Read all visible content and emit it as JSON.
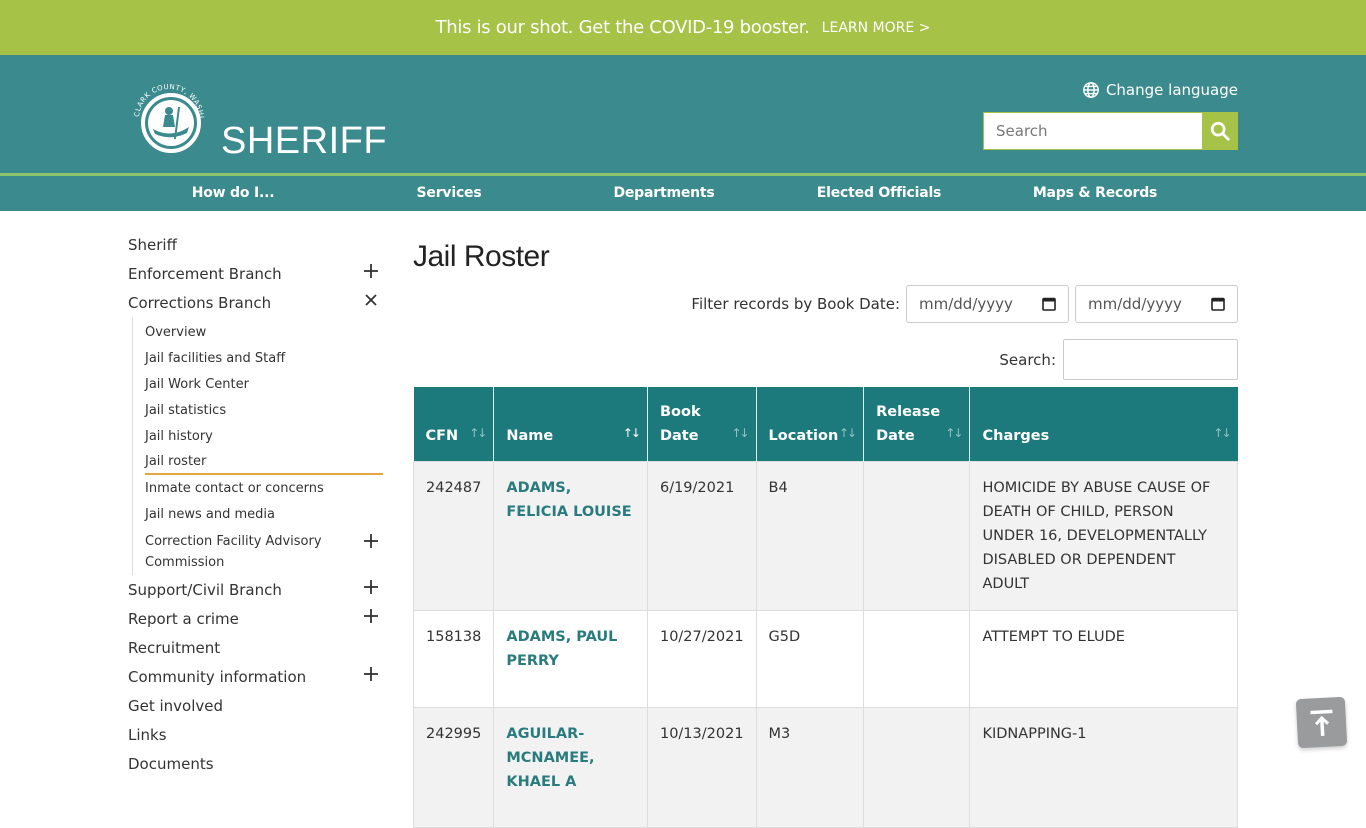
{
  "banner": {
    "message": "This is our shot. Get the COVID-19 booster.",
    "link": "LEARN MORE >"
  },
  "header": {
    "seal_text": "CLARK COUNTY, WASHINGTON",
    "brand": "SHERIFF",
    "change_language": "Change language",
    "search_placeholder": "Search"
  },
  "nav": {
    "items": [
      "How do I...",
      "Services",
      "Departments",
      "Elected Officials",
      "Maps & Records"
    ]
  },
  "sidebar": {
    "items": [
      {
        "label": "Sheriff",
        "toggle": null
      },
      {
        "label": "Enforcement Branch",
        "toggle": "plus"
      },
      {
        "label": "Corrections Branch",
        "toggle": "close"
      }
    ],
    "sub_items": [
      {
        "label": "Overview"
      },
      {
        "label": "Jail facilities and Staff"
      },
      {
        "label": "Jail Work Center"
      },
      {
        "label": "Jail statistics"
      },
      {
        "label": "Jail history"
      },
      {
        "label": "Jail roster",
        "active": true
      },
      {
        "label": "Inmate contact or concerns"
      },
      {
        "label": "Jail news and media"
      },
      {
        "label": "Correction Facility Advisory Commission",
        "toggle": "plus"
      }
    ],
    "items_after": [
      {
        "label": "Support/Civil Branch",
        "toggle": "plus"
      },
      {
        "label": "Report a crime",
        "toggle": "plus"
      },
      {
        "label": "Recruitment",
        "toggle": null
      },
      {
        "label": "Community information",
        "toggle": "plus"
      },
      {
        "label": "Get involved",
        "toggle": null
      },
      {
        "label": "Links",
        "toggle": null
      },
      {
        "label": "Documents",
        "toggle": null
      }
    ]
  },
  "main": {
    "title": "Jail Roster",
    "filter_label": "Filter records by Book Date:",
    "date_from_placeholder": "mm/dd/yyyy",
    "date_to_placeholder": "mm/dd/yyyy",
    "search_label": "Search:",
    "search_value": "",
    "table": {
      "columns": [
        {
          "line1": "",
          "line2": "CFN",
          "sorted": false
        },
        {
          "line1": "",
          "line2": "Name",
          "sorted": true
        },
        {
          "line1": "Book",
          "line2": "Date",
          "sorted": false
        },
        {
          "line1": "",
          "line2": "Location",
          "sorted": false
        },
        {
          "line1": "Release",
          "line2": "Date",
          "sorted": false
        },
        {
          "line1": "",
          "line2": "Charges",
          "sorted": false
        }
      ],
      "rows": [
        {
          "cfn": "242487",
          "name": "ADAMS, FELICIA LOUISE",
          "book_date": "6/19/2021",
          "location": "B4",
          "release_date": "",
          "charges": "HOMICIDE BY ABUSE CAUSE OF DEATH OF CHILD, PERSON UNDER 16, DEVELOPMENTALLY DISABLED OR DEPENDENT ADULT"
        },
        {
          "cfn": "158138",
          "name": "ADAMS, PAUL PERRY",
          "book_date": "10/27/2021",
          "location": "G5D",
          "release_date": "",
          "charges": "ATTEMPT TO ELUDE"
        },
        {
          "cfn": "242995",
          "name": "AGUILAR-MCNAMEE, KHAEL A",
          "book_date": "10/13/2021",
          "location": "M3",
          "release_date": "",
          "charges": "KIDNAPPING-1"
        }
      ]
    }
  },
  "colors": {
    "banner": "#a6c247",
    "header": "#3b8a8d",
    "table_header": "#1d7a7c",
    "link": "#2a7b7d",
    "active_underline": "#e8a53d"
  }
}
